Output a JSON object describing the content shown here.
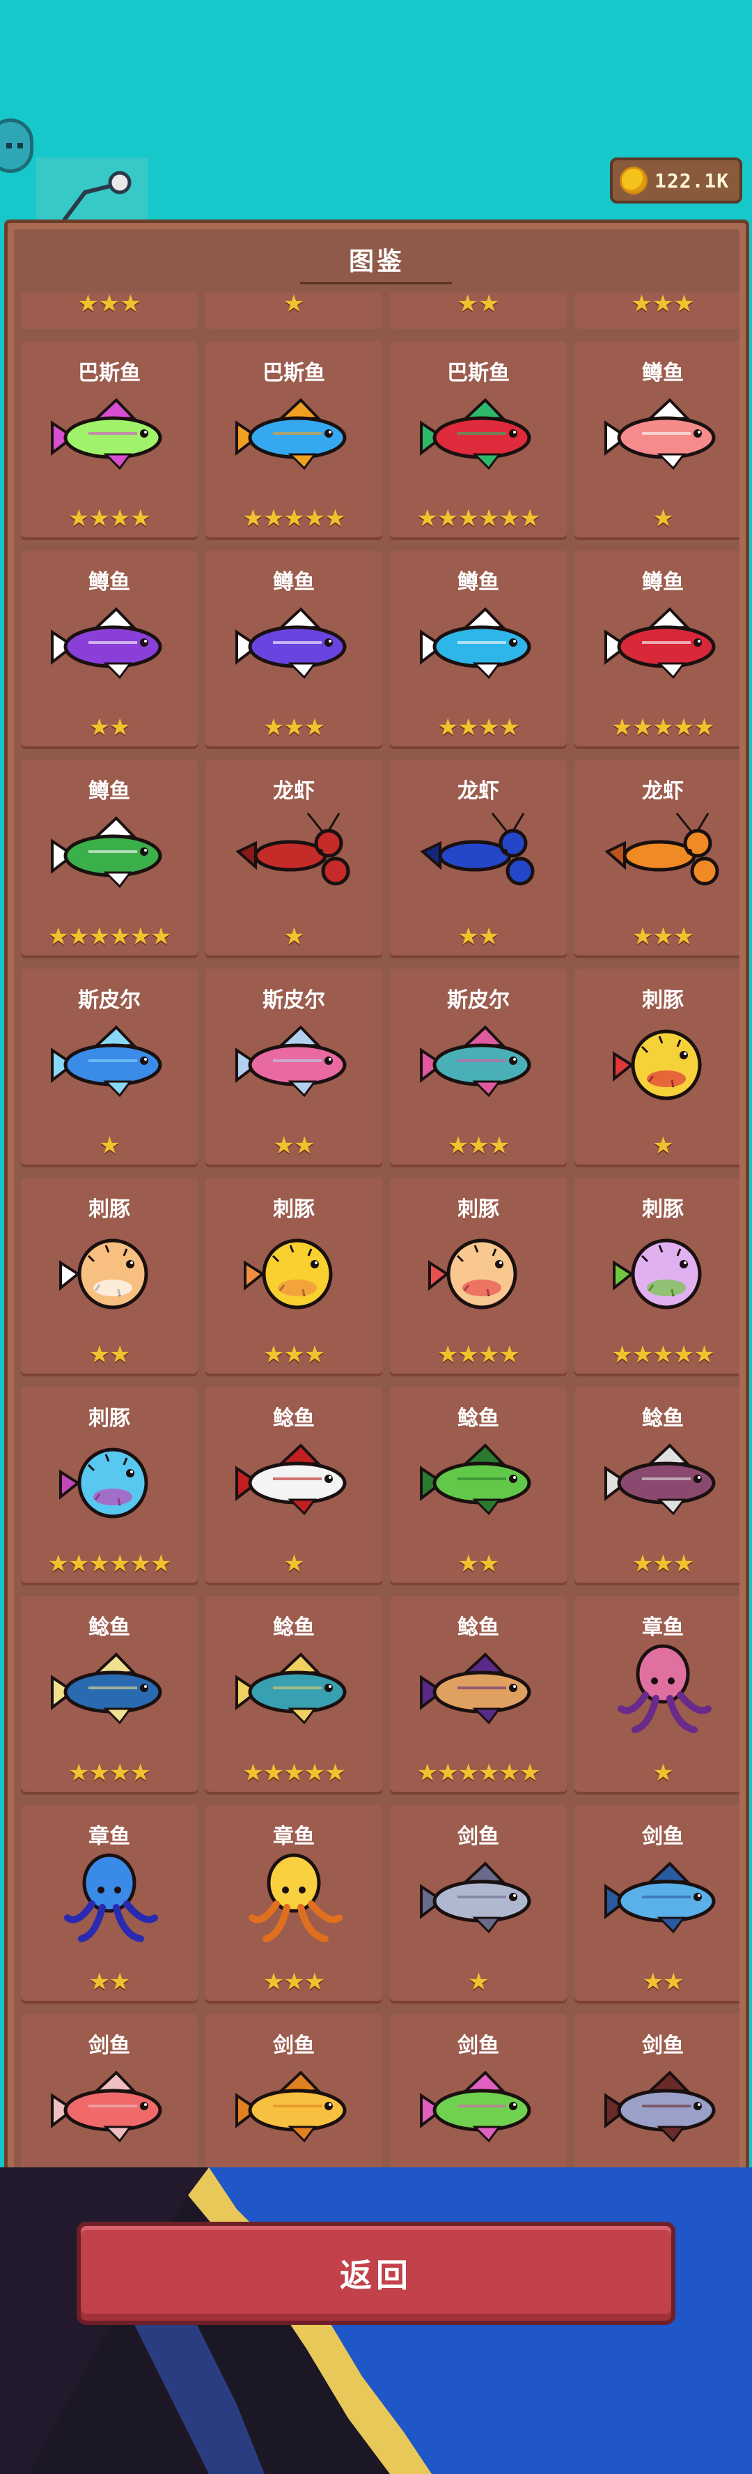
{
  "header": {
    "coins": "122.1K"
  },
  "panel": {
    "title": "图鉴",
    "top_partial_stars": [
      "★★★",
      "★",
      "★★",
      "★★★"
    ]
  },
  "cards": [
    {
      "name": "巴斯鱼",
      "stars": "★★★★",
      "color": "#9ff26a",
      "accent": "#d74fd0",
      "kind": "fish"
    },
    {
      "name": "巴斯鱼",
      "stars": "★★★★★",
      "color": "#36a8f0",
      "accent": "#f0a020",
      "kind": "fish"
    },
    {
      "name": "巴斯鱼",
      "stars": "★★★★★★",
      "color": "#e02b3c",
      "accent": "#2fb86a",
      "kind": "fish"
    },
    {
      "name": "鳟鱼",
      "stars": "★",
      "color": "#f58b8b",
      "accent": "#ffffff",
      "kind": "fish"
    },
    {
      "name": "鳟鱼",
      "stars": "★★",
      "color": "#8a3fd8",
      "accent": "#ffffff",
      "kind": "fish"
    },
    {
      "name": "鳟鱼",
      "stars": "★★★",
      "color": "#6a44e0",
      "accent": "#ffffff",
      "kind": "fish"
    },
    {
      "name": "鳟鱼",
      "stars": "★★★★",
      "color": "#2fb6e8",
      "accent": "#ffffff",
      "kind": "fish"
    },
    {
      "name": "鳟鱼",
      "stars": "★★★★★",
      "color": "#d8283a",
      "accent": "#ffffff",
      "kind": "fish"
    },
    {
      "name": "鳟鱼",
      "stars": "★★★★★★",
      "color": "#3bb04a",
      "accent": "#ffffff",
      "kind": "fish"
    },
    {
      "name": "龙虾",
      "stars": "★",
      "color": "#c52b28",
      "accent": "#8a1a1a",
      "kind": "lobster"
    },
    {
      "name": "龙虾",
      "stars": "★★",
      "color": "#2446c8",
      "accent": "#14287a",
      "kind": "lobster"
    },
    {
      "name": "龙虾",
      "stars": "★★★",
      "color": "#f08a25",
      "accent": "#b8531a",
      "kind": "lobster"
    },
    {
      "name": "斯皮尔",
      "stars": "★",
      "color": "#3b8be8",
      "accent": "#8ad8f8",
      "kind": "fish"
    },
    {
      "name": "斯皮尔",
      "stars": "★★",
      "color": "#e86aa0",
      "accent": "#b3d0f0",
      "kind": "fish"
    },
    {
      "name": "斯皮尔",
      "stars": "★★★",
      "color": "#4ab0b8",
      "accent": "#e05aa0",
      "kind": "fish"
    },
    {
      "name": "刺豚",
      "stars": "★",
      "color": "#f6d23a",
      "accent": "#e0383a",
      "kind": "puffer"
    },
    {
      "name": "刺豚",
      "stars": "★★",
      "color": "#f8c080",
      "accent": "#ffffff",
      "kind": "puffer"
    },
    {
      "name": "刺豚",
      "stars": "★★★",
      "color": "#f8d030",
      "accent": "#f09040",
      "kind": "puffer"
    },
    {
      "name": "刺豚",
      "stars": "★★★★",
      "color": "#f8c890",
      "accent": "#e85050",
      "kind": "puffer"
    },
    {
      "name": "刺豚",
      "stars": "★★★★★",
      "color": "#e0b0f0",
      "accent": "#70c840",
      "kind": "puffer"
    },
    {
      "name": "刺豚",
      "stars": "★★★★★★",
      "color": "#58c8f0",
      "accent": "#c048b8",
      "kind": "puffer"
    },
    {
      "name": "鲶鱼",
      "stars": "★",
      "color": "#f4f4f4",
      "accent": "#c02020",
      "kind": "fish"
    },
    {
      "name": "鲶鱼",
      "stars": "★★",
      "color": "#62c84a",
      "accent": "#2a7a30",
      "kind": "fish"
    },
    {
      "name": "鲶鱼",
      "stars": "★★★",
      "color": "#8a4a70",
      "accent": "#e0e0e0",
      "kind": "fish"
    },
    {
      "name": "鲶鱼",
      "stars": "★★★★",
      "color": "#2a6ab0",
      "accent": "#f0e090",
      "kind": "fish"
    },
    {
      "name": "鲶鱼",
      "stars": "★★★★★",
      "color": "#38a0b0",
      "accent": "#f0d060",
      "kind": "fish"
    },
    {
      "name": "鲶鱼",
      "stars": "★★★★★★",
      "color": "#e0a060",
      "accent": "#5a2a88",
      "kind": "fish"
    },
    {
      "name": "章鱼",
      "stars": "★",
      "color": "#e070a0",
      "accent": "#6a2a8a",
      "kind": "octopus"
    },
    {
      "name": "章鱼",
      "stars": "★★",
      "color": "#3a8ae8",
      "accent": "#2a2ab0",
      "kind": "octopus"
    },
    {
      "name": "章鱼",
      "stars": "★★★",
      "color": "#f8d040",
      "accent": "#e07020",
      "kind": "octopus"
    },
    {
      "name": "剑鱼",
      "stars": "★",
      "color": "#b0b8d0",
      "accent": "#6a6a8a",
      "kind": "fish"
    },
    {
      "name": "剑鱼",
      "stars": "★★",
      "color": "#5ab0e8",
      "accent": "#2a5aa0",
      "kind": "fish"
    },
    {
      "name": "剑鱼",
      "stars": "★★★",
      "color": "#f06a6a",
      "accent": "#f0c0c0",
      "kind": "fish"
    },
    {
      "name": "剑鱼",
      "stars": "★★★★",
      "color": "#f8c040",
      "accent": "#e08020",
      "kind": "fish"
    },
    {
      "name": "剑鱼",
      "stars": "★★★★★",
      "color": "#70d050",
      "accent": "#e060c0",
      "kind": "fish"
    },
    {
      "name": "剑鱼",
      "stars": "★★★★★★",
      "color": "#9aa0c8",
      "accent": "#6a2a2a",
      "kind": "fish"
    }
  ],
  "footer": {
    "back_label": "返回"
  },
  "colors": {
    "sky": "#16c8c9",
    "panel": "#a86a52",
    "card": "#9c5c4e",
    "star": "#f2c12e",
    "button": "#c2414a"
  }
}
